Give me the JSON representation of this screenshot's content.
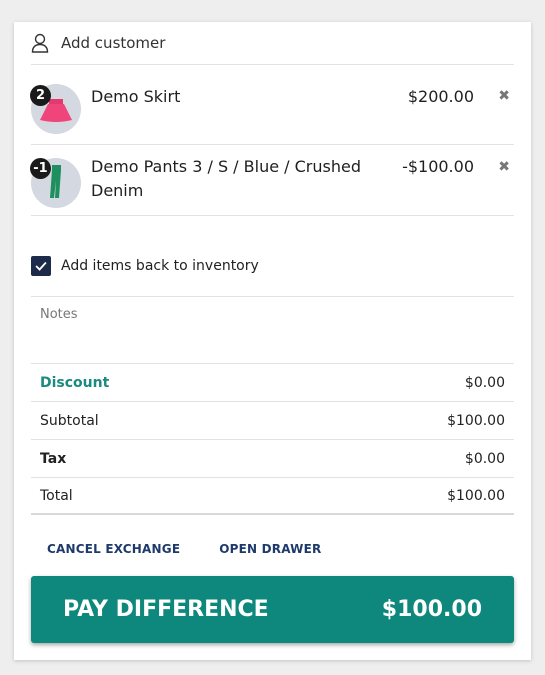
{
  "customer": {
    "label": "Add customer",
    "icon": "person-icon"
  },
  "line_items": [
    {
      "quantity": "2",
      "name": "Demo Skirt",
      "price": "$200.00",
      "thumb_icon": "skirt-icon",
      "remove_icon": "close-icon"
    },
    {
      "quantity": "-1",
      "name": "Demo Pants 3 / S / Blue / Crushed Denim",
      "price": "-$100.00",
      "thumb_icon": "pants-icon",
      "remove_icon": "close-icon"
    }
  ],
  "inventory": {
    "label": "Add items back to inventory",
    "checked": true
  },
  "notes": {
    "placeholder": "Notes"
  },
  "totals": {
    "discount_label": "Discount",
    "discount_value": "$0.00",
    "subtotal_label": "Subtotal",
    "subtotal_value": "$100.00",
    "tax_label": "Tax",
    "tax_value": "$0.00",
    "total_label": "Total",
    "total_value": "$100.00"
  },
  "actions": {
    "cancel": "CANCEL EXCHANGE",
    "open_drawer": "OPEN DRAWER"
  },
  "pay": {
    "label": "PAY DIFFERENCE",
    "amount": "$100.00"
  },
  "colors": {
    "accent": "#0e877d",
    "discount": "#1b8a80",
    "checkbox": "#1d2a4a",
    "link": "#1d3a6b",
    "skirt": "#f0457a",
    "pants": "#1e8f5e"
  }
}
